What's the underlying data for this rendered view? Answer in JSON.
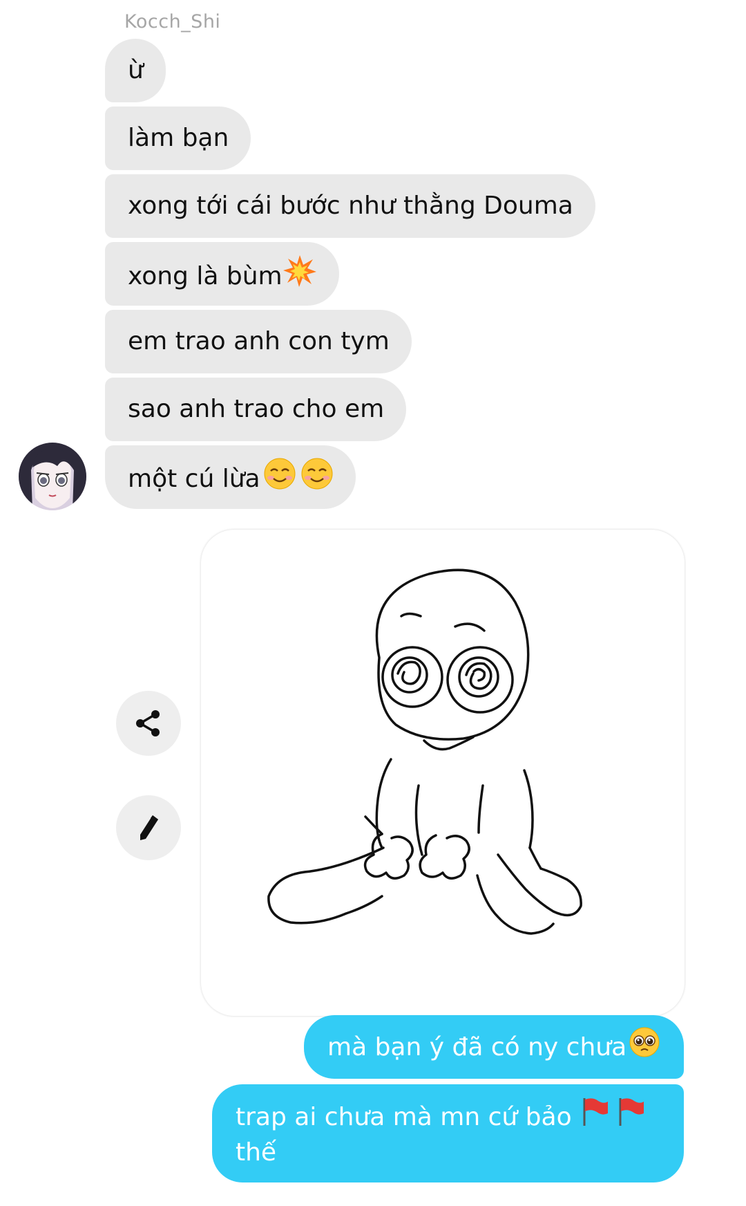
{
  "thread": {
    "sender_name": "Kocch_Shi",
    "incoming_messages": [
      {
        "text": "ừ"
      },
      {
        "text": "làm bạn"
      },
      {
        "text": "xong tới cái bước như thằng Douma"
      },
      {
        "text": "xong là bùm"
      },
      {
        "text": "em trao anh con tym"
      },
      {
        "text": "sao anh trao cho em"
      },
      {
        "text": "một cú lừa"
      }
    ],
    "outgoing_messages": [
      {
        "text": "mà bạn ý đã có ny chưa"
      },
      {
        "text_line1": "trap ai chưa mà mn cứ bảo",
        "text_line2": "thế"
      }
    ]
  },
  "icons": {
    "avatar": "anime-avatar-icon",
    "explosion": "collision-emoji-icon",
    "smile": "smiling-face-emoji-icon",
    "pleading": "pleading-face-emoji-icon",
    "flag": "red-flag-emoji-icon",
    "share": "share-icon",
    "edit": "pencil-icon"
  },
  "colors": {
    "incoming_bubble": "#e9e9e9",
    "outgoing_bubble": "#33ccf5",
    "sender_name": "#a6a6a6",
    "side_button": "#eeeeee"
  }
}
